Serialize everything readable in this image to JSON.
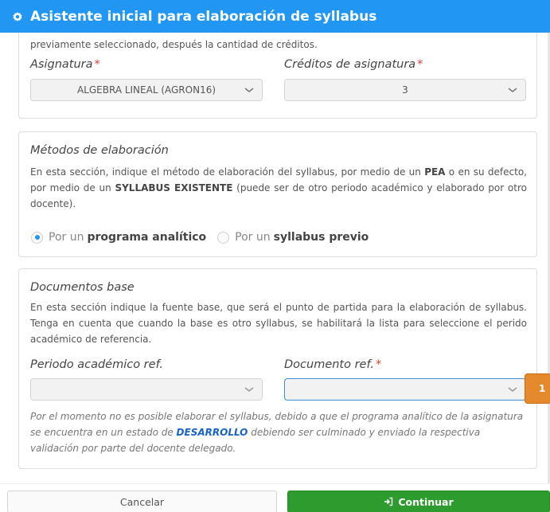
{
  "dialog": {
    "title": "Asistente inicial para elaboración de syllabus",
    "title_icon": "gear-icon"
  },
  "intro": {
    "text": "previamente seleccionado, después la cantidad de créditos."
  },
  "asignatura": {
    "label": "Asignatura",
    "required_mark": "*",
    "value": "ALGEBRA LINEAL (AGRON16)"
  },
  "creditos": {
    "label": "Créditos de asignatura",
    "required_mark": "*",
    "value": "3"
  },
  "metodos": {
    "title": "Métodos de elaboración",
    "desc_1": "En esta sección, indique el método de elaboración del syllabus, por medio de un ",
    "desc_pea": "PEA",
    "desc_2": " o en su defecto, por medio de un ",
    "desc_syllabus": "SYLLABUS EXISTENTE",
    "desc_3": " (puede ser de otro periodo académico y elaborado por otro docente).",
    "option1_prefix": "Por un",
    "option1_bold": "programa analítico",
    "option1_checked": true,
    "option2_prefix": "Por un",
    "option2_bold": "syllabus previo",
    "option2_checked": false
  },
  "documentos": {
    "title": "Documentos base",
    "desc": "En esta sección indique la fuente base, que será el punto de partida para la elaboración de syllabus. Tenga en cuenta que cuando la base es otro syllabus, se habilitará la lista para seleccione el perido académico de referencia.",
    "periodo_label": "Periodo académico ref.",
    "periodo_value": "",
    "documento_label": "Documento ref.",
    "documento_required_mark": "*",
    "documento_value": "",
    "note_1": "Por el momento no es posible elaborar el syllabus, debido a que el programa analítico de la asignatura se encuentra en un estado de ",
    "note_link": "DESARROLLO",
    "note_2": " debiendo ser culminado y enviado la respectiva validación por parte del docente delegado."
  },
  "badge": {
    "label": "1"
  },
  "footer": {
    "cancel_label": "Cancelar",
    "continue_label": "Continuar",
    "continue_icon": "sign-in-icon"
  },
  "colors": {
    "header": "#2196f3",
    "continue": "#2e9b2e",
    "badge": "#e58a2c",
    "required": "#e53935",
    "link": "#1a63c6"
  }
}
